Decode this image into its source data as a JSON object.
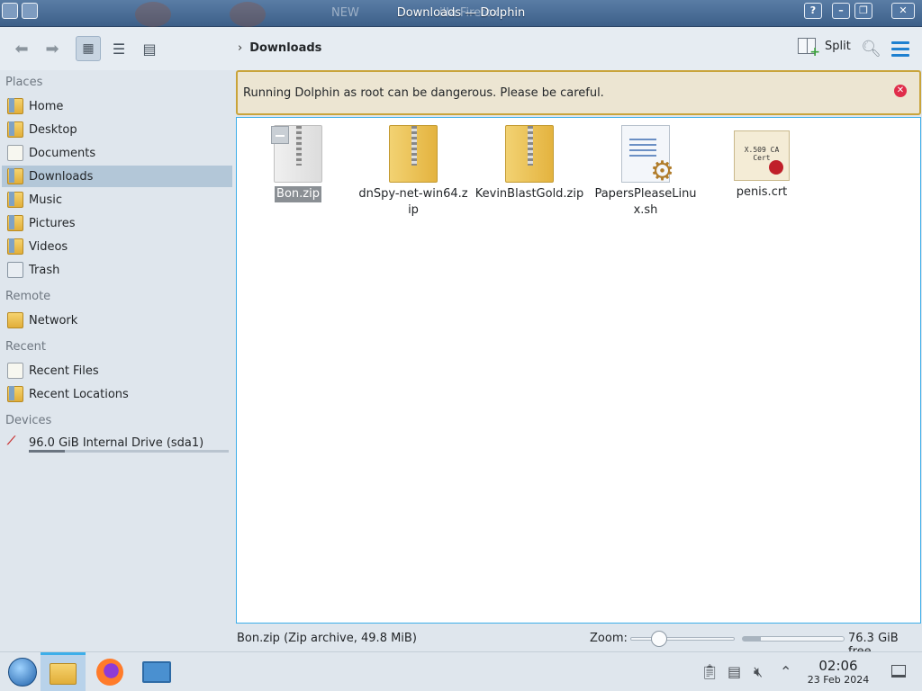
{
  "window": {
    "title": "Downloads — Dolphin",
    "background_title_fragment_1": "NEW",
    "background_title_fragment_2": "illa Firefox"
  },
  "toolbar": {
    "back_icon": "arrow-left-icon",
    "forward_icon": "arrow-right-icon",
    "breadcrumb": "Downloads",
    "split_label": "Split"
  },
  "sidebar": {
    "places_title": "Places",
    "places": [
      {
        "label": "Home",
        "icon": "home-folder-icon"
      },
      {
        "label": "Desktop",
        "icon": "desktop-folder-icon"
      },
      {
        "label": "Documents",
        "icon": "documents-icon"
      },
      {
        "label": "Downloads",
        "icon": "downloads-folder-icon",
        "selected": true
      },
      {
        "label": "Music",
        "icon": "music-folder-icon"
      },
      {
        "label": "Pictures",
        "icon": "pictures-folder-icon"
      },
      {
        "label": "Videos",
        "icon": "videos-folder-icon"
      },
      {
        "label": "Trash",
        "icon": "trash-icon"
      }
    ],
    "remote_title": "Remote",
    "remote": [
      {
        "label": "Network",
        "icon": "network-folder-icon"
      }
    ],
    "recent_title": "Recent",
    "recent": [
      {
        "label": "Recent Files",
        "icon": "recent-files-icon"
      },
      {
        "label": "Recent Locations",
        "icon": "recent-locations-icon"
      }
    ],
    "devices_title": "Devices",
    "devices": [
      {
        "label": "96.0 GiB Internal Drive (sda1)",
        "icon": "drive-icon",
        "usage_fraction": 0.18
      }
    ]
  },
  "banner": {
    "message": "Running Dolphin as root can be dangerous. Please be careful."
  },
  "files": [
    {
      "name": "Bon.zip",
      "type": "zip",
      "selected": true
    },
    {
      "name": "dnSpy-net-win64.zip",
      "type": "zip"
    },
    {
      "name": "KevinBlastGold.zip",
      "type": "zip"
    },
    {
      "name": "PapersPleaseLinux.sh",
      "type": "shell-script"
    },
    {
      "name": "penis.crt",
      "type": "certificate",
      "cert_text": "X.509 CA Cert"
    }
  ],
  "statusbar": {
    "info": "Bon.zip (Zip archive, 49.8 MiB)",
    "zoom_label": "Zoom:",
    "free_label": "76.3 GiB free",
    "used_fraction": 0.18
  },
  "taskbar": {
    "time": "02:06",
    "date": "23 Feb 2024"
  },
  "colors": {
    "accent": "#3daee9",
    "selection": "#b3c7d8",
    "banner_border": "#c9a43b",
    "close_red": "#e02d4b"
  }
}
